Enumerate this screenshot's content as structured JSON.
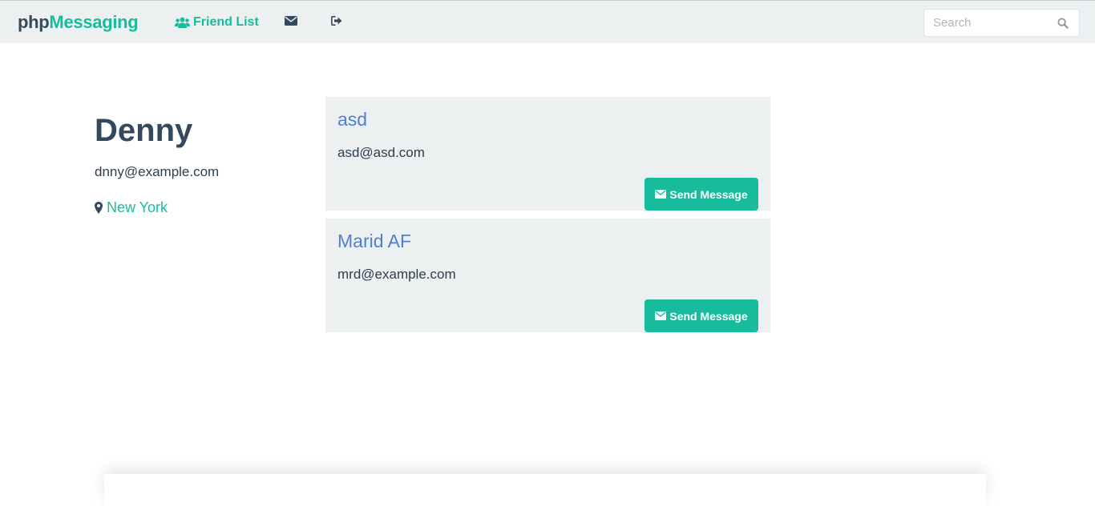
{
  "navbar": {
    "brand_prefix": "php",
    "brand_suffix": "Messaging",
    "friend_list_label": "Friend List",
    "envelope_icon": "envelope-icon",
    "logout_icon": "sign-out-icon",
    "search": {
      "placeholder": "Search",
      "value": "",
      "icon": "search-icon"
    }
  },
  "profile": {
    "name": "Denny",
    "email": "dnny@example.com",
    "location": "New York",
    "location_icon": "map-marker-icon"
  },
  "friends": [
    {
      "name": "asd",
      "email": "asd@asd.com",
      "button_label": "Send Message"
    },
    {
      "name": "Marid AF",
      "email": "mrd@example.com",
      "button_label": "Send Message"
    }
  ],
  "colors": {
    "primary": "#2c3e50",
    "accent": "#18bc9c",
    "link": "#4e7fd4",
    "navbar_bg": "#ecf0f1",
    "card_bg": "#ecf0f1"
  }
}
